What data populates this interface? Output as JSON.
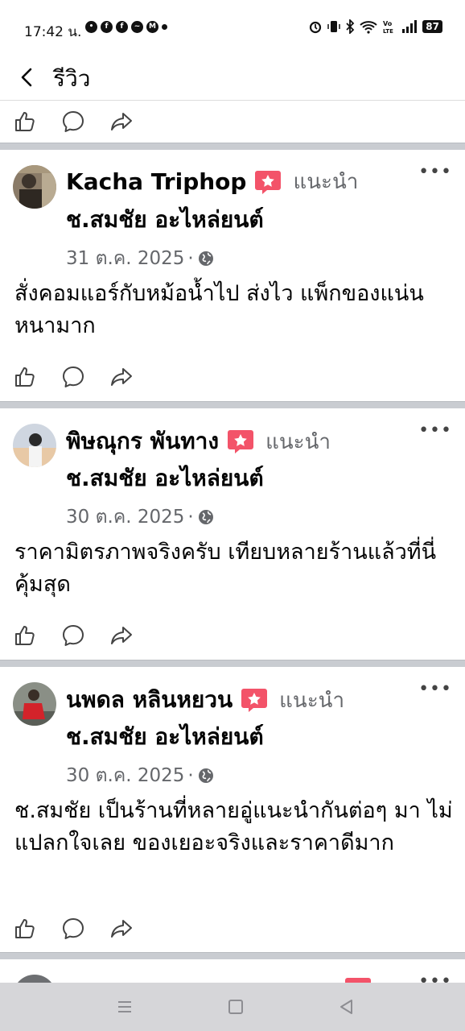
{
  "status": {
    "time": "17:42 น.",
    "notifications": [
      "chat-bubble",
      "facebook",
      "facebook",
      "messenger",
      "gmail",
      "dot"
    ],
    "battery": "87"
  },
  "header": {
    "title": "รีวิว"
  },
  "action_icons": [
    "like-icon",
    "comment-icon",
    "share-icon"
  ],
  "recommend_color": "#f35369",
  "reviews": [
    {
      "name": "Kacha Triphop",
      "recommend_label": "แนะนำ",
      "page": "ช.สมชัย อะไหล่ยนต์",
      "date": "31 ต.ค. 2025",
      "sep": "·",
      "text": "สั่งคอมแอร์กับหม้อน้ำไป ส่งไว แพ็กของแน่นหนามาก",
      "more": "•••"
    },
    {
      "name": "พิษณุกร พันทาง",
      "recommend_label": "แนะนำ",
      "page": "ช.สมชัย อะไหล่ยนต์",
      "date": "30 ต.ค. 2025",
      "sep": "·",
      "text": "ราคามิตรภาพจริงครับ เทียบหลายร้านแล้วที่นี่คุ้มสุด",
      "more": "•••"
    },
    {
      "name": "นพดล หลินหยวน",
      "recommend_label": "แนะนำ",
      "page": "ช.สมชัย อะไหล่ยนต์",
      "date": "30 ต.ค. 2025",
      "sep": "·",
      "text": "ช.สมชัย เป็นร้านที่หลายอู่แนะนำกันต่อๆ มา ไม่แปลกใจเลย ของเยอะจริงและราคาดีมาก",
      "more": "•••"
    }
  ]
}
